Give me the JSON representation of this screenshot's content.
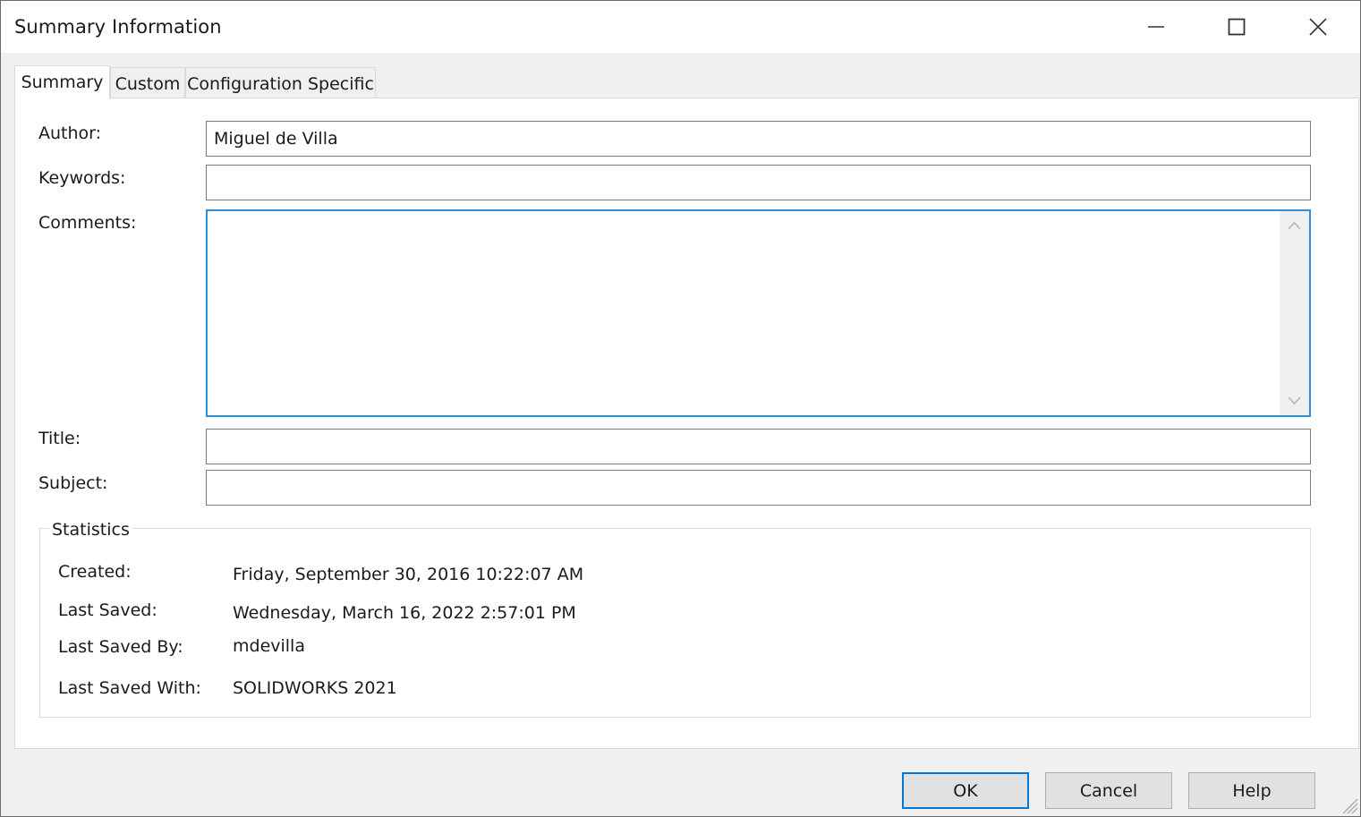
{
  "window": {
    "title": "Summary Information",
    "controls": {
      "minimize": "minimize-icon",
      "maximize": "maximize-icon",
      "close": "close-icon"
    }
  },
  "tabs": [
    {
      "label": "Summary",
      "active": true
    },
    {
      "label": "Custom",
      "active": false
    },
    {
      "label": "Configuration Specific",
      "active": false
    }
  ],
  "form": {
    "author": {
      "label": "Author:",
      "value": "Miguel de Villa"
    },
    "keywords": {
      "label": "Keywords:",
      "value": ""
    },
    "comments": {
      "label": "Comments:",
      "value": ""
    },
    "title": {
      "label": "Title:",
      "value": ""
    },
    "subject": {
      "label": "Subject:",
      "value": ""
    }
  },
  "statistics": {
    "heading": "Statistics",
    "rows": [
      {
        "label": "Created:",
        "value": "Friday, September 30, 2016 10:22:07 AM"
      },
      {
        "label": "Last Saved:",
        "value": "Wednesday, March 16, 2022 2:57:01 PM"
      },
      {
        "label": "Last Saved By:",
        "value": "mdevilla"
      },
      {
        "label": "Last Saved With:",
        "value": "SOLIDWORKS 2021"
      }
    ]
  },
  "buttons": {
    "ok": "OK",
    "cancel": "Cancel",
    "help": "Help"
  },
  "colors": {
    "focus_accent": "#2f8fd8",
    "default_button_border": "#0078d7"
  }
}
